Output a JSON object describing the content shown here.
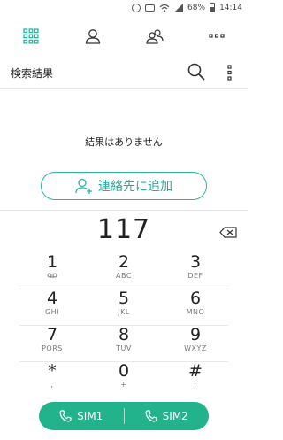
{
  "status_bar": {
    "battery": "68%",
    "time": "14:14"
  },
  "tabs": [
    {
      "name": "dialpad",
      "icon": "grid-icon"
    },
    {
      "name": "contacts",
      "icon": "person-icon"
    },
    {
      "name": "groups",
      "icon": "group-icon"
    },
    {
      "name": "more",
      "icon": "more-dots-icon"
    }
  ],
  "search_header": {
    "title": "検索結果"
  },
  "empty_message": "結果はありません",
  "add_contact_label": "連絡先に追加",
  "dial_number": "117",
  "keys": [
    {
      "digit": "1",
      "letters": ""
    },
    {
      "digit": "2",
      "letters": "ABC"
    },
    {
      "digit": "3",
      "letters": "DEF"
    },
    {
      "digit": "4",
      "letters": "GHI"
    },
    {
      "digit": "5",
      "letters": "JKL"
    },
    {
      "digit": "6",
      "letters": "MNO"
    },
    {
      "digit": "7",
      "letters": "PQRS"
    },
    {
      "digit": "8",
      "letters": "TUV"
    },
    {
      "digit": "9",
      "letters": "WXYZ"
    },
    {
      "digit": "*",
      "letters": ","
    },
    {
      "digit": "0",
      "letters": "+"
    },
    {
      "digit": "#",
      "letters": ";"
    }
  ],
  "call_buttons": {
    "sim1": "SIM1",
    "sim2": "SIM2"
  },
  "colors": {
    "accent": "#2bb3a3",
    "call_bar": "#22b38c"
  }
}
